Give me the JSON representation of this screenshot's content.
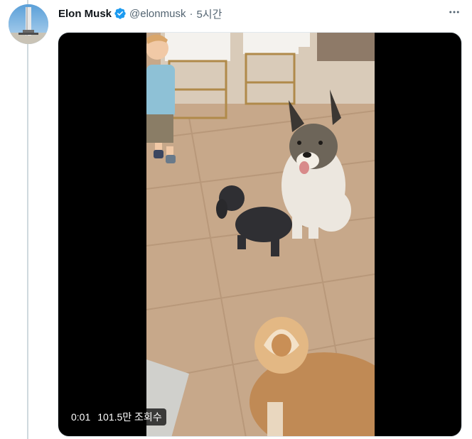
{
  "tweet": {
    "author_name": "Elon Musk",
    "author_handle": "@elonmusk",
    "separator": "·",
    "timestamp": "5시간",
    "verified": true,
    "more_icon": "more-horizontal-icon",
    "verified_icon": "verified-badge-icon",
    "verified_color": "#1d9bf0"
  },
  "video": {
    "elapsed": "0:01",
    "views": "101.5만 조회수"
  }
}
